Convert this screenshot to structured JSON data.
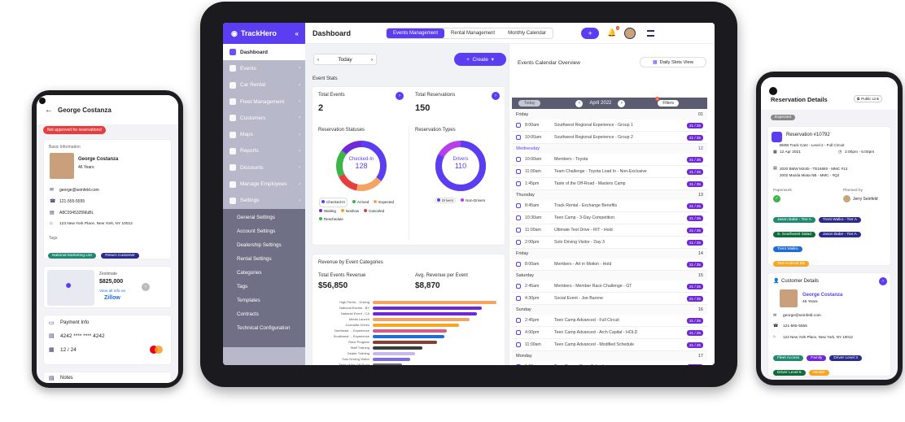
{
  "tablet": {
    "app_name": "TrackHero",
    "page_title": "Dashboard",
    "tabs": [
      "Events Management",
      "Rental Management",
      "Monthly Calendar"
    ],
    "sidebar": [
      "Dashboard",
      "Events",
      "Car Rental",
      "Fleet Management",
      "Customers",
      "Maps",
      "Reports",
      "Discounts",
      "Manage Employees",
      "Settings"
    ],
    "settings_sub": [
      "General Settings",
      "Account Settings",
      "Dealership Settings",
      "Rental Settings",
      "Categories",
      "Tags",
      "Templates",
      "Contracts",
      "Technical Configuration"
    ],
    "today": "Today",
    "create": "Create",
    "event_stats": "Event Stats",
    "total_events_lbl": "Total Events",
    "total_events": "2",
    "total_res_lbl": "Total Reservations",
    "total_res": "150",
    "res_status_lbl": "Reservation Statuses",
    "donut1_label": "Checked-In",
    "donut1_val": "128",
    "res_types_lbl": "Reservation Types",
    "donut2_label": "Drivers",
    "donut2_val": "110",
    "legend1": [
      "Checked-In",
      "Arrived",
      "Expected",
      "Waiting",
      "Noshow",
      "Canceled",
      "Reschedule"
    ],
    "legend2": [
      "Drivers",
      "Non-Drivers"
    ],
    "rev_title": "Revenue by Event Categories",
    "tot_rev_lbl": "Total Events Revenue",
    "tot_rev": "$56,850",
    "avg_rev_lbl": "Avg. Revenue per Event",
    "avg_rev": "$8,870",
    "cal_title": "Events Calendar Overview",
    "daily_btn": "Daily Slots View",
    "today_btn": "Today",
    "month": "April 2022",
    "filters": "Filters",
    "filters_count": "3",
    "notif_count": "1",
    "calendar": [
      {
        "day": "Friday",
        "num": "01",
        "rows": [
          [
            "8:00am",
            "Southwest Regional Experience - Group 1",
            "21 / 25"
          ],
          [
            "10:00am",
            "Southwest Regional Experience - Group 2",
            "21 / 25"
          ]
        ]
      },
      {
        "day": "Wednesday",
        "num": "12",
        "rows": [
          [
            "10:00am",
            "Members - Toyota",
            "21 / 25"
          ],
          [
            "11:00am",
            "Team Challenge - Toyota Load In - Non-Exclusive",
            "21 / 25"
          ],
          [
            "1:45pm",
            "Taste of the Off-Road - Masters Camp",
            "21 / 25"
          ]
        ]
      },
      {
        "day": "Thursday",
        "num": "13",
        "rows": [
          [
            "8:45am",
            "Track Rental - Exchange Benefits",
            "21 / 25"
          ],
          [
            "10:30am",
            "Teen Camp - 3-Day Competition",
            "21 / 25"
          ],
          [
            "11:00am",
            "Ultimate Test Drive - RIT - Hold",
            "21 / 25"
          ],
          [
            "2:00pm",
            "Solo Driving Visitor - Day 3",
            "21 / 25"
          ]
        ]
      },
      {
        "day": "Friday",
        "num": "14",
        "rows": [
          [
            "8:00am",
            "Members - Art in Motion - Hold",
            "21 / 25"
          ]
        ]
      },
      {
        "day": "Saturday",
        "num": "15",
        "rows": [
          [
            "2:45am",
            "Members - Member Race Challenge - GT",
            "21 / 25"
          ],
          [
            "4:30pm",
            "Social Event - Joe Barone",
            "21 / 25"
          ]
        ]
      },
      {
        "day": "Sunday",
        "num": "16",
        "rows": [
          [
            "2:45pm",
            "Teen Camp Advanced - Full Circuit",
            "21 / 25"
          ],
          [
            "4:00pm",
            "Teen Camp Advanced - Arch Capital - HOLD",
            "21 / 25"
          ],
          [
            "11:00am",
            "Teen Camp Advanced - Modified Schedule",
            "21 / 25"
          ]
        ]
      },
      {
        "day": "Monday",
        "num": "17",
        "rows": [
          [
            "1:00am",
            "Teen Camp - Race School",
            "21 / 25"
          ]
        ]
      }
    ]
  },
  "chart_data": {
    "type": "bar",
    "title": "Revenue by Event Categories",
    "categories": [
      "High Perfor... Driving",
      "National Events - BY",
      "National Event - CA",
      "Media Launch",
      "Journalist Drives",
      "Northeast ... Experience",
      "Southwest ... Experience",
      "Race Program",
      "Staff Training",
      "Dealer Training",
      "Solo Driving Visitor",
      "Taste of the Off-Road",
      "Teen Camp",
      "Teen Camp Advanced"
    ],
    "values": [
      100,
      88,
      84,
      78,
      70,
      60,
      58,
      52,
      40,
      34,
      30,
      24,
      18,
      12
    ],
    "colors": [
      "#f4a460",
      "#6f28d9",
      "#6f28d9",
      "#f4a460",
      "#f6a623",
      "#e0568a",
      "#1e6cd6",
      "#8b3d2e",
      "#3b3b3b",
      "#c9b7f0",
      "#7b6fd9",
      "#6f6f85",
      "#6f28d9",
      "#5b3ef2"
    ]
  },
  "phone_left": {
    "name": "George Costanza",
    "warning": "Not approved for reservations!",
    "basic_info": "Basic Information",
    "person": "George Costanza",
    "age": "46 Years",
    "email": "george@seinfeld.com",
    "phone": "121-555-5555",
    "id": "A8C0345325MuBL",
    "address": "123 New York Place, New York, NY 10012",
    "tags_lbl": "Tags",
    "tags": [
      "National Marketing List",
      "Return Customer"
    ],
    "zestimate_lbl": "Zestimate",
    "zestimate": "$825,000",
    "zillow_link": "View all info on",
    "zillow": "Zillow",
    "payment": "Payment Info",
    "card": "4242 **** **** 4242",
    "exp": "12 / 24",
    "notes": "Notes"
  },
  "phone_right": {
    "title": "Reservation Details",
    "public_link": "Public Link",
    "status": "Expected",
    "res_no": "Reservation #10792",
    "track": "BMW Track Cars - Level 2 - Full Circuit",
    "date": "12 Apr 2021",
    "time": "2:00pm - 5:00pm",
    "cars": "2020 BMW M240i - TE16850 - MMC #13",
    "cars2": "2002 Mazda Miata NB - MMC - #Q2",
    "paperwork_lbl": "Paperwork",
    "planned_lbl": "Planned by",
    "planner": "Jerry Seinfeld",
    "tags": [
      "Jason Babe - Tier A",
      "Trent Walko - Tier A",
      "S. Southwest Salad",
      "Jason Babe - Tier A",
      "Trent Walko",
      "Test Android EB"
    ],
    "customer_details": "Customer Details",
    "cust_name": "George Costanza",
    "cust_age": "46 Years",
    "email": "george@seinfeld.com",
    "phone": "121-555-5555",
    "address": "123 New York Place, New York, NY 10012",
    "cust_tags": [
      "Fleet Access",
      "Family",
      "Driver Level 3",
      "Driver Level 5",
      "Vendor"
    ]
  }
}
